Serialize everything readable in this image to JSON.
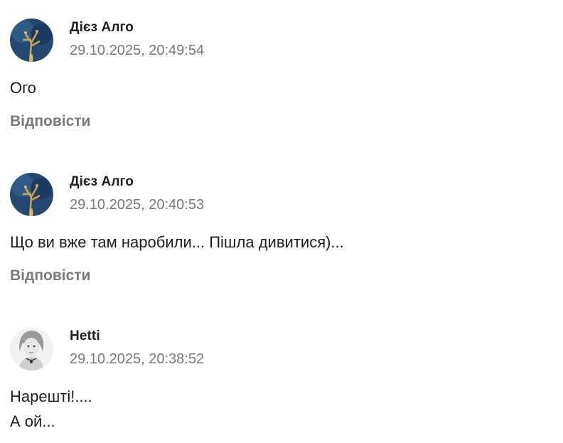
{
  "colors": {
    "author_text": "#1f1f1f",
    "meta_text": "#7a7a7a",
    "body_text": "#1f1f1f",
    "avatar_blue": "#24486f",
    "avatar_gold": "#c9a35a"
  },
  "comments": [
    {
      "author": "Дієз Алго",
      "timestamp": "29.10.2025, 20:49:54",
      "lines": [
        "Ого"
      ],
      "reply_label": "Відповісти",
      "avatar_icon": "tree-artwork-avatar"
    },
    {
      "author": "Дієз Алго",
      "timestamp": "29.10.2025, 20:40:53",
      "lines": [
        "Що ви вже там наробили... Пішла дивитися)..."
      ],
      "reply_label": "Відповісти",
      "avatar_icon": "tree-artwork-avatar"
    },
    {
      "author": "Hetti",
      "timestamp": "29.10.2025, 20:38:52",
      "lines": [
        "Нарешті!....",
        "А ой..."
      ],
      "avatar_icon": "girl-portrait-avatar"
    }
  ]
}
